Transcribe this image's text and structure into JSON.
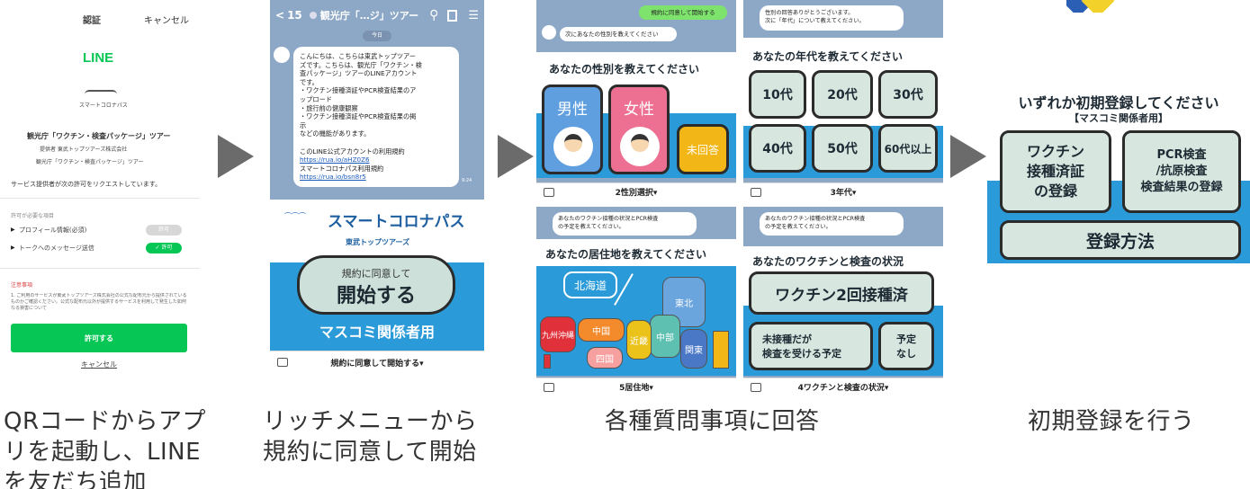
{
  "steps": [
    {
      "caption": "QRコードからアプリを起動し、LINEを友だち追加",
      "screen": {
        "header_title": "認証",
        "header_cancel": "キャンセル",
        "brand": "LINE",
        "logo_text": "スマートコロナパス",
        "service_name": "観光庁「ワクチン・検査パッケージ」ツアー",
        "provider": "提供者 東武トップツアーズ株式会社",
        "service_sub": "観光庁「ワクチン・検査パッケージ」ツアー",
        "request_text": "サービス提供者が次の許可をリクエストしています。",
        "permissions_header": "許可が必要な項目",
        "permissions": [
          {
            "label": "プロフィール情報(必須)",
            "state": "許可"
          },
          {
            "label": "トークへのメッセージ送信",
            "state": "✓ 許可"
          }
        ],
        "notes_header": "注意事項",
        "notes_text": "1. ご利用のサービスが東武トップツアーズ株式会社の公式な配布元から提供されているものかご確認ください。公式な配布元以外が提供するサービスを利用して発生した如何なる損害について",
        "allow_button": "許可する",
        "cancel_link": "キャンセル"
      }
    },
    {
      "caption": "リッチメニューから規約に同意して開始",
      "screen": {
        "back_count": "15",
        "chat_title": "観光庁「…ジ」ツアー",
        "date_chip": "今日",
        "message_lines": [
          "こんにちは、こちらは東武トップツアー",
          "ズです。こちらは、観光庁「ワクチン・検",
          "査パッケージ」ツアーのLINEアカウント",
          "です。",
          "・ワクチン接種済証やPCR検査結果のア",
          "ップロード",
          "・旅行前の健康観察",
          "・ワクチン接種済証やPCR検査結果の掲",
          "示",
          "などの機能があります。",
          "",
          "このLINE公式アカウントの利用規約"
        ],
        "link1": "https://rua.io/aHZ0Z6",
        "link2_label": "スマートコロナパス利用規約",
        "link2": "https://rua.io/bsn8r5",
        "msg_time": "9:24",
        "banner_title": "スマートコロナパス",
        "banner_company": "東武トップツアーズ",
        "agree_small": "規約に同意して",
        "agree_big": "開始する",
        "press_label": "マスコミ関係者用",
        "footer": "規約に同意して開始する▾"
      }
    },
    {
      "caption": "各種質問事項に回答",
      "panels": {
        "gender": {
          "user_msg": "規約に同意して開始する",
          "bot_msg": "次にあなたの性別を教えてください",
          "title": "あなたの性別を教えてください",
          "options": [
            "男性",
            "女性",
            "未回答"
          ],
          "footer": "2性別選択▾"
        },
        "age": {
          "bot_msg_1": "性別の回答ありがとうございます。",
          "bot_msg_2": "次に「年代」について教えてください。",
          "title": "あなたの年代を教えてください",
          "options": [
            "10代",
            "20代",
            "30代",
            "40代",
            "50代",
            "60代以上"
          ],
          "footer": "3年代▾"
        },
        "residence": {
          "bot_msg_1": "あなたのワクチン接種の状況とPCR検査",
          "bot_msg_2": "の予定を教えてください。",
          "title": "あなたの居住地を教えてください",
          "regions": [
            "北海道",
            "東北",
            "関東",
            "中部",
            "近畿",
            "中国",
            "四国",
            "九州沖縄"
          ],
          "footer": "5居住地▾"
        },
        "vaccine": {
          "bot_msg_1": "あなたのワクチン接種の状況とPCR検査",
          "bot_msg_2": "の予定を教えてください。",
          "title": "あなたのワクチンと検査の状況",
          "option_main": "ワクチン2回接種済",
          "option_a_1": "未接種だが",
          "option_a_2": "検査を受ける予定",
          "option_b_1": "予定",
          "option_b_2": "なし",
          "footer": "4ワクチンと検査の状況▾"
        }
      }
    },
    {
      "caption": "初期登録を行う",
      "screen": {
        "title": "いずれか初期登録してください",
        "subtitle": "【マスコミ関係者用】",
        "btn_vaccine_1": "ワクチン",
        "btn_vaccine_2": "接種済証",
        "btn_vaccine_3": "の登録",
        "btn_pcr_1": "PCR検査",
        "btn_pcr_2": "/抗原検査",
        "btn_pcr_3": "検査結果の登録",
        "btn_method": "登録方法"
      }
    }
  ]
}
